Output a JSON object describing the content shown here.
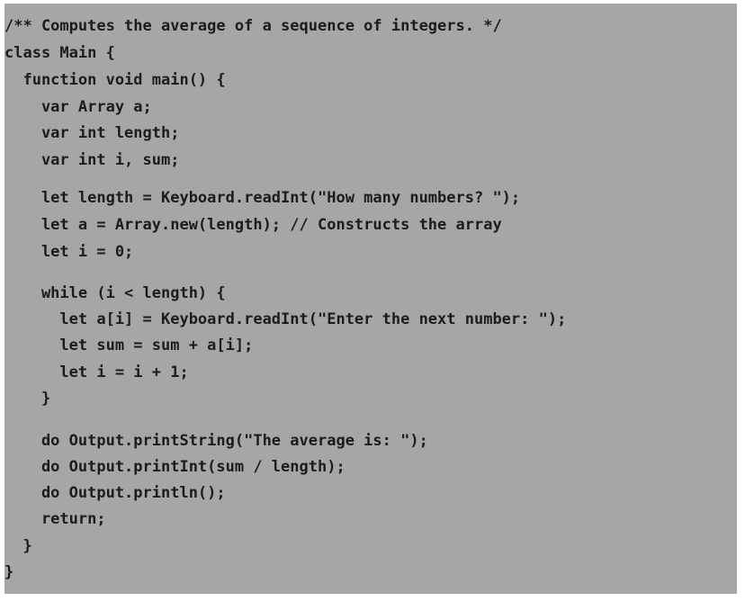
{
  "code": {
    "lines": [
      "/** Computes the average of a sequence of integers. */",
      "class Main {",
      "  function void main() {",
      "    var Array a;",
      "    var int length;",
      "    var int i, sum;",
      "    let length = Keyboard.readInt(\"How many numbers? \");",
      "    let a = Array.new(length); // Constructs the array",
      "    let i = 0;",
      "    while (i < length) {",
      "      let a[i] = Keyboard.readInt(\"Enter the next number: \");",
      "      let sum = sum + a[i];",
      "      let i = i + 1;",
      "    }",
      "    do Output.printString(\"The average is: \");",
      "    do Output.printInt(sum / length);",
      "    do Output.println();",
      "    return;",
      "  }",
      "}"
    ]
  }
}
